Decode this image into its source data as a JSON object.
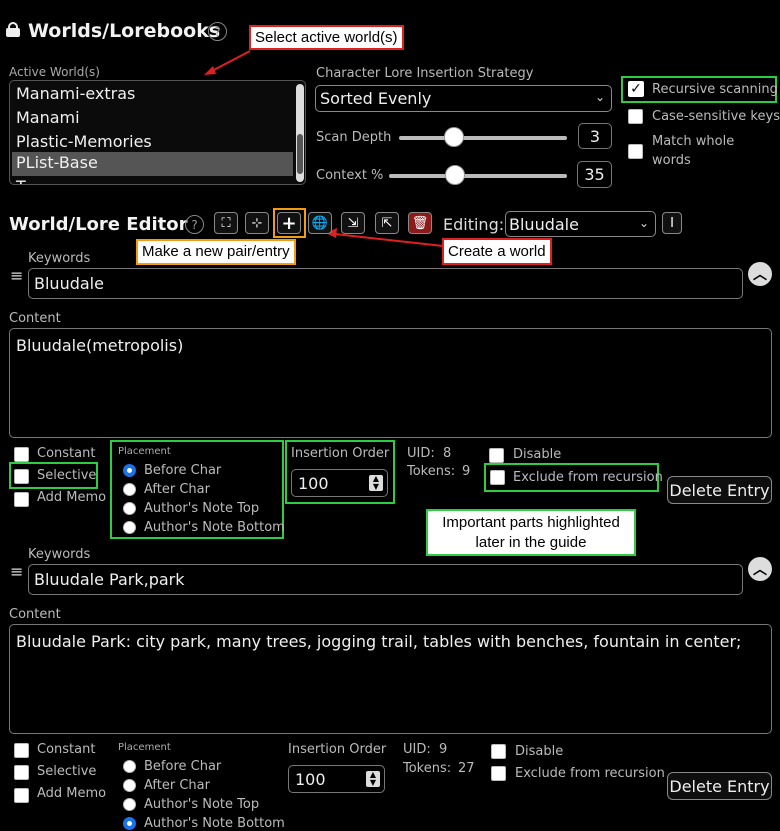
{
  "header": {
    "title": "Worlds/Lorebooks",
    "help": "?"
  },
  "annotations": {
    "select_world": "Select active world(s)",
    "make_pair": "Make a new pair/entry",
    "create_world": "Create a world",
    "important_line1": "Important parts highlighted",
    "important_line2": "later in the guide"
  },
  "active_worlds": {
    "label": "Active World(s)",
    "items": [
      "Manami-extras",
      "Manami",
      "Plastic-Memories",
      "PList-Base",
      "T..."
    ]
  },
  "strategy": {
    "label": "Character Lore Insertion Strategy",
    "value": "Sorted Evenly"
  },
  "scan_depth": {
    "label": "Scan Depth",
    "value": "3",
    "level": 0.25
  },
  "context": {
    "label": "Context %",
    "value": "35",
    "level": 0.25
  },
  "options": {
    "recursive": "Recursive scanning",
    "case_sensitive": "Case-sensitive keys",
    "match_whole_1": "Match whole",
    "match_whole_2": "words"
  },
  "editor": {
    "title": "World/Lore Editor",
    "help": "?",
    "editing_label": "Editing:",
    "editing_value": "Bluudale"
  },
  "entries": [
    {
      "keywords_label": "Keywords",
      "keywords": "Bluudale",
      "content_label": "Content",
      "content": "Bluudale(metropolis)",
      "constant": "Constant",
      "selective": "Selective",
      "add_memo": "Add Memo",
      "placement_label": "Placement",
      "placements": [
        "Before Char",
        "After Char",
        "Author's Note Top",
        "Author's Note Bottom"
      ],
      "insertion_label": "Insertion Order",
      "insertion_value": "100",
      "uid_label": "UID:",
      "uid": "8",
      "tokens_label": "Tokens:",
      "tokens": "9",
      "disable": "Disable",
      "exclude": "Exclude from recursion",
      "delete": "Delete Entry"
    },
    {
      "keywords_label": "Keywords",
      "keywords": "Bluudale Park,park",
      "content_label": "Content",
      "content": "Bluudale Park: city park, many trees, jogging trail, tables with benches, fountain in center;",
      "constant": "Constant",
      "selective": "Selective",
      "add_memo": "Add Memo",
      "placement_label": "Placement",
      "placements": [
        "Before Char",
        "After Char",
        "Author's Note Top",
        "Author's Note Bottom"
      ],
      "insertion_label": "Insertion Order",
      "insertion_value": "100",
      "uid_label": "UID:",
      "uid": "9",
      "tokens_label": "Tokens:",
      "tokens": "27",
      "disable": "Disable",
      "exclude": "Exclude from recursion",
      "delete": "Delete Entry"
    }
  ]
}
